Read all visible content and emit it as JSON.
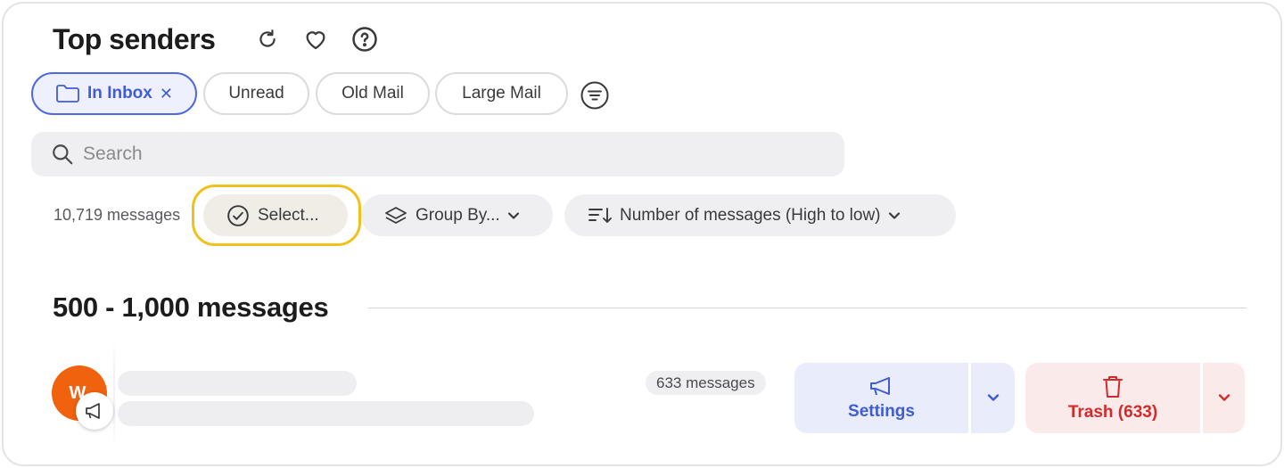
{
  "header": {
    "title": "Top senders",
    "icons": [
      "refresh-icon",
      "heart-icon",
      "help-icon"
    ]
  },
  "filters": {
    "chips": [
      {
        "label": "In Inbox",
        "active": true,
        "icon": "folder-icon"
      },
      {
        "label": "Unread",
        "active": false
      },
      {
        "label": "Old Mail",
        "active": false
      },
      {
        "label": "Large Mail",
        "active": false
      }
    ],
    "remove_symbol": "✕",
    "more_icon": "filter-lines-icon"
  },
  "search": {
    "placeholder": "Search",
    "value": ""
  },
  "toolbar": {
    "count": "10,719 messages",
    "select_label": "Select...",
    "group_by_label": "Group By...",
    "sort_label": "Number of messages (High to low)"
  },
  "section": {
    "title": "500 - 1,000 messages"
  },
  "sender": {
    "avatar_letter": "W",
    "avatar_color": "#f0620e",
    "message_count": "633 messages",
    "settings_label": "Settings",
    "trash_label": "Trash (633)"
  },
  "colors": {
    "accent": "#3f5bd6",
    "danger": "#d52a2a",
    "highlight": "#f0c11b"
  }
}
